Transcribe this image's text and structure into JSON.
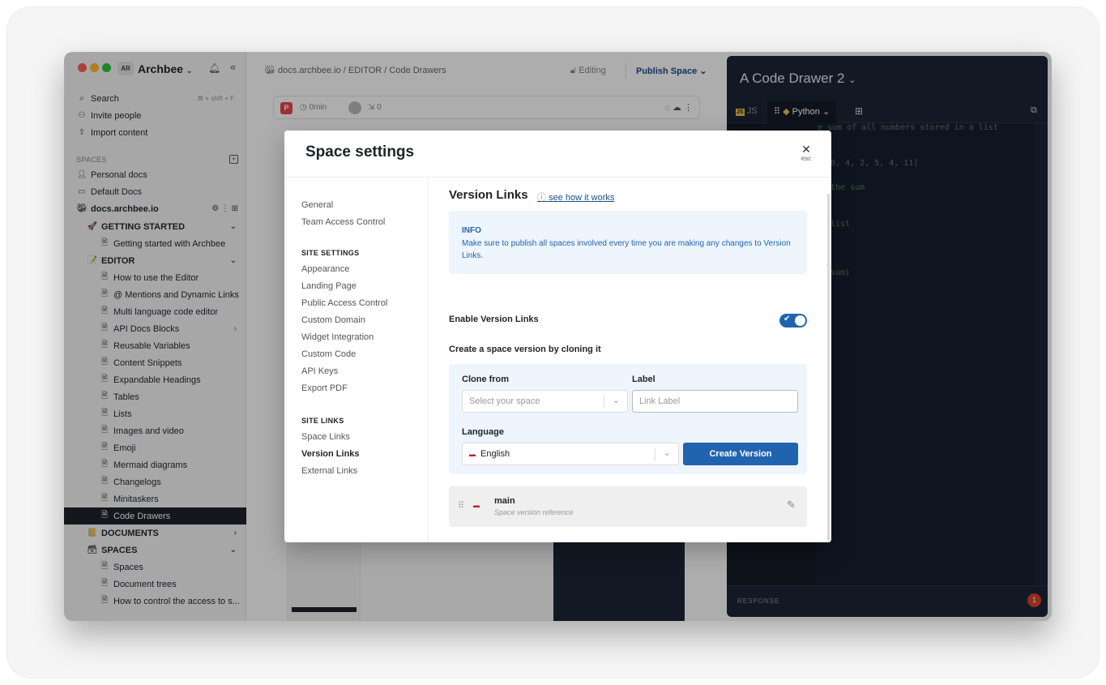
{
  "sidebar": {
    "avatar": "AR",
    "workspace": "Archbee",
    "search_label": "Search",
    "search_shortcut": "⌘ + shift + F",
    "invite": "Invite people",
    "import": "Import content",
    "spaces_header": "SPACES",
    "spaces": [
      "Personal docs",
      "Default Docs",
      "docs.archbee.io"
    ],
    "items": [
      {
        "label": "GETTING STARTED",
        "level": 1,
        "icon": "🚀",
        "chevron": "⌄",
        "bold": true
      },
      {
        "label": "Getting started with Archbee",
        "level": 2
      },
      {
        "label": "EDITOR",
        "level": 1,
        "icon": "📝",
        "chevron": "⌄",
        "bold": true
      },
      {
        "label": "How to use the Editor",
        "level": 2
      },
      {
        "label": "@ Mentions and Dynamic Links",
        "level": 2
      },
      {
        "label": "Multi language code editor",
        "level": 2
      },
      {
        "label": "API Docs Blocks",
        "level": 2,
        "chevron": "›"
      },
      {
        "label": "Reusable Variables",
        "level": 2
      },
      {
        "label": "Content Snippets",
        "level": 2
      },
      {
        "label": "Expandable Headings",
        "level": 2
      },
      {
        "label": "Tables",
        "level": 2
      },
      {
        "label": "Lists",
        "level": 2
      },
      {
        "label": "Images and video",
        "level": 2
      },
      {
        "label": "Emoji",
        "level": 2
      },
      {
        "label": "Mermaid diagrams",
        "level": 2
      },
      {
        "label": "Changelogs",
        "level": 2
      },
      {
        "label": "Minitaskers",
        "level": 2
      },
      {
        "label": "Code Drawers",
        "level": 2,
        "active": true
      },
      {
        "label": "DOCUMENTS",
        "level": 1,
        "icon": "📒",
        "chevron": "›",
        "bold": true
      },
      {
        "label": "SPACES",
        "level": 1,
        "icon": "🗃",
        "chevron": "⌄",
        "bold": true
      },
      {
        "label": "Spaces",
        "level": 2
      },
      {
        "label": "Document trees",
        "level": 2
      },
      {
        "label": "How to control the access to s...",
        "level": 2
      }
    ]
  },
  "editor": {
    "breadcrumb": "docs.archbee.io  /  EDITOR  /  Code Drawers",
    "editing": "Editing",
    "publish": "Publish Space",
    "toolbar_author": "P",
    "toolbar_time": "0min",
    "toolbar_count": "0"
  },
  "drawer": {
    "title": "A Code Drawer 2",
    "tabs": [
      "JS",
      "Python"
    ],
    "code_lines": [
      "e sum of all numbers stored in a list",
      "8, 4, 2, 5, 4, 11]",
      "the sum",
      "list",
      "sum)"
    ],
    "response": "RESPONSE",
    "notification_count": "1"
  },
  "modal": {
    "title": "Space settings",
    "close_hint": "esc",
    "nav": {
      "general": [
        "General",
        "Team Access Control"
      ],
      "site_settings_header": "SITE SETTINGS",
      "site_settings": [
        "Appearance",
        "Landing Page",
        "Public Access Control",
        "Custom Domain",
        "Widget Integration",
        "Custom Code",
        "API Keys",
        "Export PDF"
      ],
      "site_links_header": "SITE LINKS",
      "site_links": [
        "Space Links",
        "Version Links",
        "External Links"
      ],
      "active": "Version Links"
    },
    "section_title": "Version Links",
    "help_link": "see how it works",
    "info_title": "INFO",
    "info_text": "Make sure to publish all spaces involved every time you are making any changes to Version Links.",
    "enable_label": "Enable Version Links",
    "enable_on": true,
    "create_label": "Create a space version by cloning it",
    "clone_from_label": "Clone from",
    "clone_from_placeholder": "Select your space",
    "label_label": "Label",
    "label_placeholder": "Link Label",
    "language_label": "Language",
    "language_value": "English",
    "create_button": "Create Version",
    "versions": [
      {
        "name": "main",
        "subtitle": "Space version reference"
      }
    ]
  },
  "colors": {
    "accent": "#2064b0",
    "info_bg": "#eef5fd",
    "drawer_bg": "#1d2535",
    "link": "#1a4d8c"
  }
}
